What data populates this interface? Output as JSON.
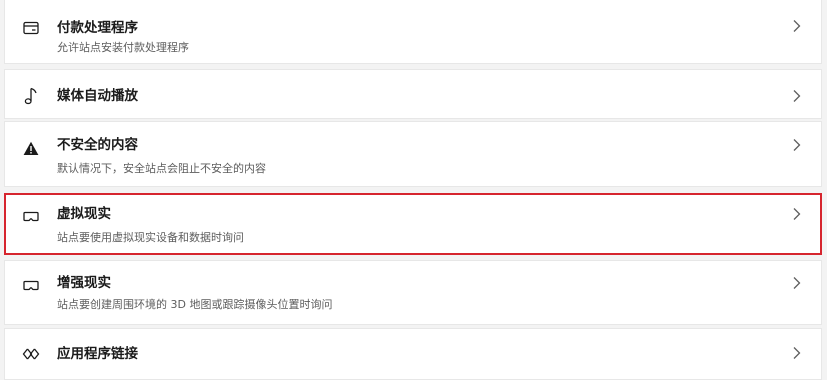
{
  "settings": {
    "items": [
      {
        "title": "付款处理程序",
        "subtitle": "允许站点安装付款处理程序",
        "icon": "card-icon"
      },
      {
        "title": "媒体自动播放",
        "subtitle": "",
        "icon": "music-note-icon"
      },
      {
        "title": "不安全的内容",
        "subtitle": "默认情况下，安全站点会阻止不安全的内容",
        "icon": "warning-icon"
      },
      {
        "title": "虚拟现实",
        "subtitle": "站点要使用虚拟现实设备和数据时询问",
        "icon": "vr-headset-icon"
      },
      {
        "title": "增强现实",
        "subtitle": "站点要创建周围环境的 3D 地图或跟踪摄像头位置时询问",
        "icon": "ar-headset-icon"
      },
      {
        "title": "应用程序链接",
        "subtitle": "",
        "icon": "app-links-icon"
      }
    ]
  },
  "colors": {
    "highlight_border": "#d6252e",
    "row_background": "#ffffff",
    "page_background": "#f3f3f3"
  }
}
